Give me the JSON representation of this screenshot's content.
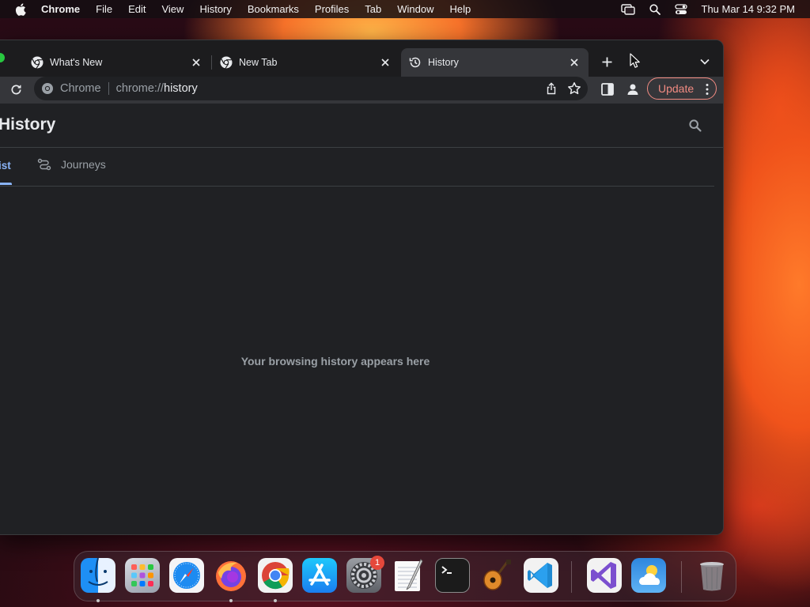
{
  "menubar": {
    "app_name": "Chrome",
    "items": [
      "File",
      "Edit",
      "View",
      "History",
      "Bookmarks",
      "Profiles",
      "Tab",
      "Window",
      "Help"
    ],
    "clock": "Thu Mar 14  9:32 PM"
  },
  "tabs": [
    {
      "title": "What's New",
      "icon": "chrome-icon",
      "active": false
    },
    {
      "title": "New Tab",
      "icon": "chrome-icon",
      "active": false
    },
    {
      "title": "History",
      "icon": "history-icon",
      "active": true
    }
  ],
  "omnibox": {
    "scheme_label": "Chrome",
    "url_prefix": "chrome://",
    "url_host": "history"
  },
  "toolbar": {
    "update_label": "Update"
  },
  "page": {
    "title": "History",
    "tabs": [
      {
        "label": "ist",
        "selected": true
      },
      {
        "label": "Journeys",
        "selected": false
      }
    ],
    "empty_message": "Your browsing history appears here"
  },
  "dock": {
    "apps": [
      "Finder",
      "Launchpad",
      "Safari",
      "Firefox",
      "Google Chrome",
      "App Store",
      "System Settings",
      "TextEdit",
      "Terminal",
      "GarageBand",
      "Visual Studio Code",
      "Visual Studio",
      "Weather",
      "Trash"
    ],
    "settings_badge": "1"
  },
  "colors": {
    "accent_blue": "#8ab4f8",
    "update_red": "#f28b82",
    "window_bg": "#202124"
  }
}
